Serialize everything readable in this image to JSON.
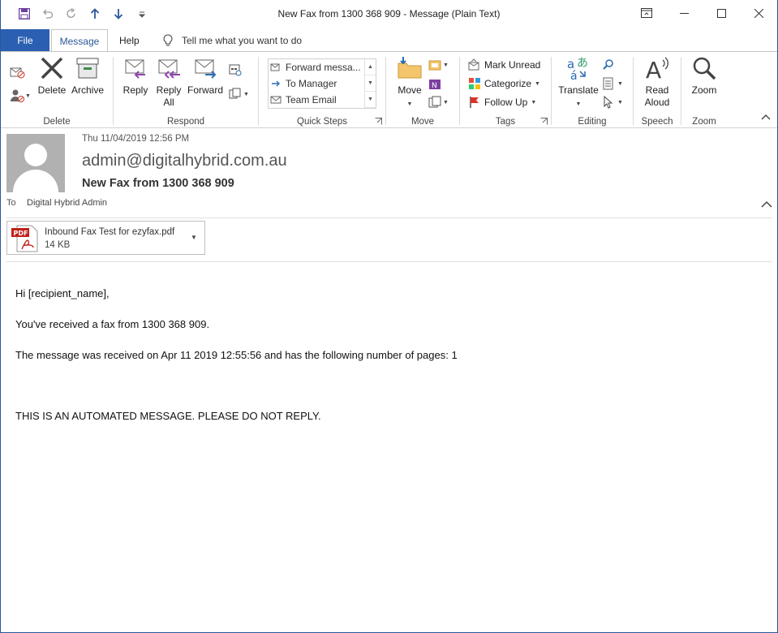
{
  "window": {
    "title": "New Fax from 1300 368 909  -  Message (Plain Text)"
  },
  "tabs": {
    "file": "File",
    "message": "Message",
    "help": "Help",
    "tell_me": "Tell me what you want to do"
  },
  "ribbon": {
    "delete_group": {
      "label": "Delete",
      "delete": "Delete",
      "archive": "Archive"
    },
    "respond_group": {
      "label": "Respond",
      "reply": "Reply",
      "reply_all_1": "Reply",
      "reply_all_2": "All",
      "forward": "Forward"
    },
    "quick_steps": {
      "label": "Quick Steps",
      "items": [
        "Forward messa...",
        "To Manager",
        "Team Email"
      ]
    },
    "move_group": {
      "label": "Move",
      "move": "Move"
    },
    "tags_group": {
      "label": "Tags",
      "mark_unread": "Mark Unread",
      "categorize": "Categorize",
      "follow_up": "Follow Up"
    },
    "editing_group": {
      "label": "Editing",
      "translate": "Translate"
    },
    "speech_group": {
      "label": "Speech",
      "read_aloud_1": "Read",
      "read_aloud_2": "Aloud"
    },
    "zoom_group": {
      "label": "Zoom",
      "zoom": "Zoom"
    }
  },
  "message": {
    "date": "Thu 11/04/2019 12:56 PM",
    "from": "admin@digitalhybrid.com.au",
    "subject": "New Fax from 1300 368 909",
    "to_label": "To",
    "to_value": "Digital Hybrid Admin",
    "attachment": {
      "name": "Inbound Fax Test for ezyfax.pdf",
      "size": "14 KB",
      "icon_label": "PDF"
    },
    "body": [
      "Hi [recipient_name],",
      "You've received a fax from 1300 368 909.",
      "The message was received on Apr 11 2019 12:55:56 and has the following number of pages: 1",
      "THIS IS AN AUTOMATED MESSAGE. PLEASE DO NOT REPLY."
    ]
  },
  "colors": {
    "accent": "#2b579a",
    "file_tab": "#2b5fb1",
    "avatar_bg": "#b1b1b1"
  }
}
